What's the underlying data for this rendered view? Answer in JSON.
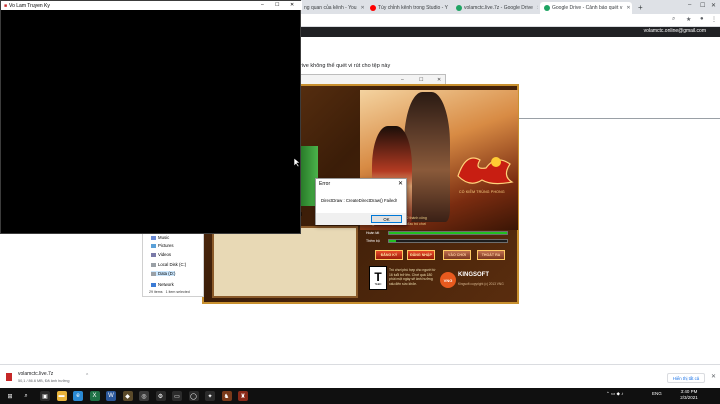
{
  "chrome": {
    "tabs": [
      {
        "title": "ng quan của kênh - You",
        "favicon_color": "#ff0000",
        "active": false
      },
      {
        "title": "Tùy chỉnh kênh trong Studio - Y",
        "favicon_color": "#ff0000",
        "active": false
      },
      {
        "title": "volamctc.live.7z - Google Drive",
        "favicon_color": "#1fa463",
        "active": false
      },
      {
        "title": "Google Drive - Cảnh báo quét v",
        "favicon_color": "#1fa463",
        "active": true
      }
    ],
    "new_tab": "+",
    "window_controls": {
      "minimize": "–",
      "maximize": "☐",
      "close": "✕"
    },
    "account_email": "volamctc.online@gmail.com"
  },
  "drive_page": {
    "heading": "rive không thể quét vi rút cho tệp này"
  },
  "console_window": {
    "title": "Vo Lam Truyen Ky",
    "controls": {
      "minimize": "–",
      "maximize": "☐",
      "close": "✕"
    }
  },
  "bg_window": {
    "controls": {
      "minimize": "–",
      "maximize": "☐",
      "close": "✕"
    }
  },
  "launcher": {
    "logo_subtitle": "CỔ KIẾM TRÙNG PHONG",
    "status_lines": [
      "cập nhật phiên bản 1.3.2 thành công",
      "ng ĐĂNG NHẬP để bắt đầu trò chơi"
    ],
    "bar1_label": "Hoàn tất",
    "bar1_fill": 1.0,
    "bar2_label": "Thêm bộ",
    "bar2_fill": 0.06,
    "buttons": [
      "ĐĂNG KÝ",
      "ĐĂNG NHẬP",
      "VÀO CHƠI",
      "THOÁT RA"
    ],
    "rating_letter": "T",
    "rating_caption": "TEEN",
    "warning_text": "Trò chơi phù hợp cho người từ 16 tuổi trở lên. Chơi quá 180 phút một ngày sẽ ảnh hưởng xấu đến sức khỏe.",
    "vng_label": "VNG",
    "kingsoft": "KINGSOFT",
    "copyright": "Kingsoft copyright (c) 2013 VNG",
    "small_b_text": "B"
  },
  "error_dialog": {
    "title": "Error",
    "message": "DirectDraw : CreateDirectDraw() Failed!",
    "ok_label": "OK",
    "close_glyph": "✕"
  },
  "explorer": {
    "nav_items": [
      {
        "label": "Music",
        "icon_color": "#6b8bd6",
        "selected": false
      },
      {
        "label": "Pictures",
        "icon_color": "#5aa0d8",
        "selected": false
      },
      {
        "label": "Videos",
        "icon_color": "#7a7aa8",
        "selected": false
      },
      {
        "label": "Local Disk (C:)",
        "icon_color": "#9aa0a6",
        "selected": false
      },
      {
        "label": "Data (D:)",
        "icon_color": "#9aa0a6",
        "selected": true
      },
      {
        "label": "Network",
        "icon_color": "#3a7bd5",
        "selected": false
      }
    ],
    "status_items": "29 items",
    "status_selected": "1 item selected"
  },
  "download_bar": {
    "file_name": "volamctc.live.7z",
    "meta": "50,1 / 86.6 MB, Đã ảnh hưởng",
    "more_glyph": "⌃",
    "show_all": "Hiển thị tất cả",
    "close_glyph": "✕"
  },
  "taskbar": {
    "start_glyph": "⊞",
    "search_glyph": "⌕",
    "apps": [
      {
        "name": "task-view-icon",
        "color": "#2b2b2b",
        "glyph": "▣"
      },
      {
        "name": "file-explorer-icon",
        "color": "#e8b43c",
        "glyph": "▬"
      },
      {
        "name": "edge-icon",
        "color": "#2a8ad4",
        "glyph": "e"
      },
      {
        "name": "excel-icon",
        "color": "#1e7145",
        "glyph": "X"
      },
      {
        "name": "word-icon",
        "color": "#2b579a",
        "glyph": "W"
      },
      {
        "name": "game-app-icon",
        "color": "#5a4a2a",
        "glyph": "◆"
      },
      {
        "name": "chrome-icon",
        "color": "#3a3a3a",
        "glyph": "◎"
      },
      {
        "name": "settings-icon",
        "color": "#2b2b2b",
        "glyph": "⚙"
      },
      {
        "name": "terminal-icon",
        "color": "#2b2b2b",
        "glyph": "▭"
      },
      {
        "name": "media-icon",
        "color": "#2b2b2b",
        "glyph": "◯"
      },
      {
        "name": "tool-icon",
        "color": "#2b2b2b",
        "glyph": "✦"
      },
      {
        "name": "game-launcher-icon",
        "color": "#7a3a1a",
        "glyph": "♞"
      },
      {
        "name": "game-client-icon",
        "color": "#8a2a1a",
        "glyph": "♜"
      }
    ],
    "tray_icons": "⌃  ▭  ◆  ♪",
    "language": "ENG",
    "time": "3:40 PM",
    "date": "2/3/2021"
  }
}
